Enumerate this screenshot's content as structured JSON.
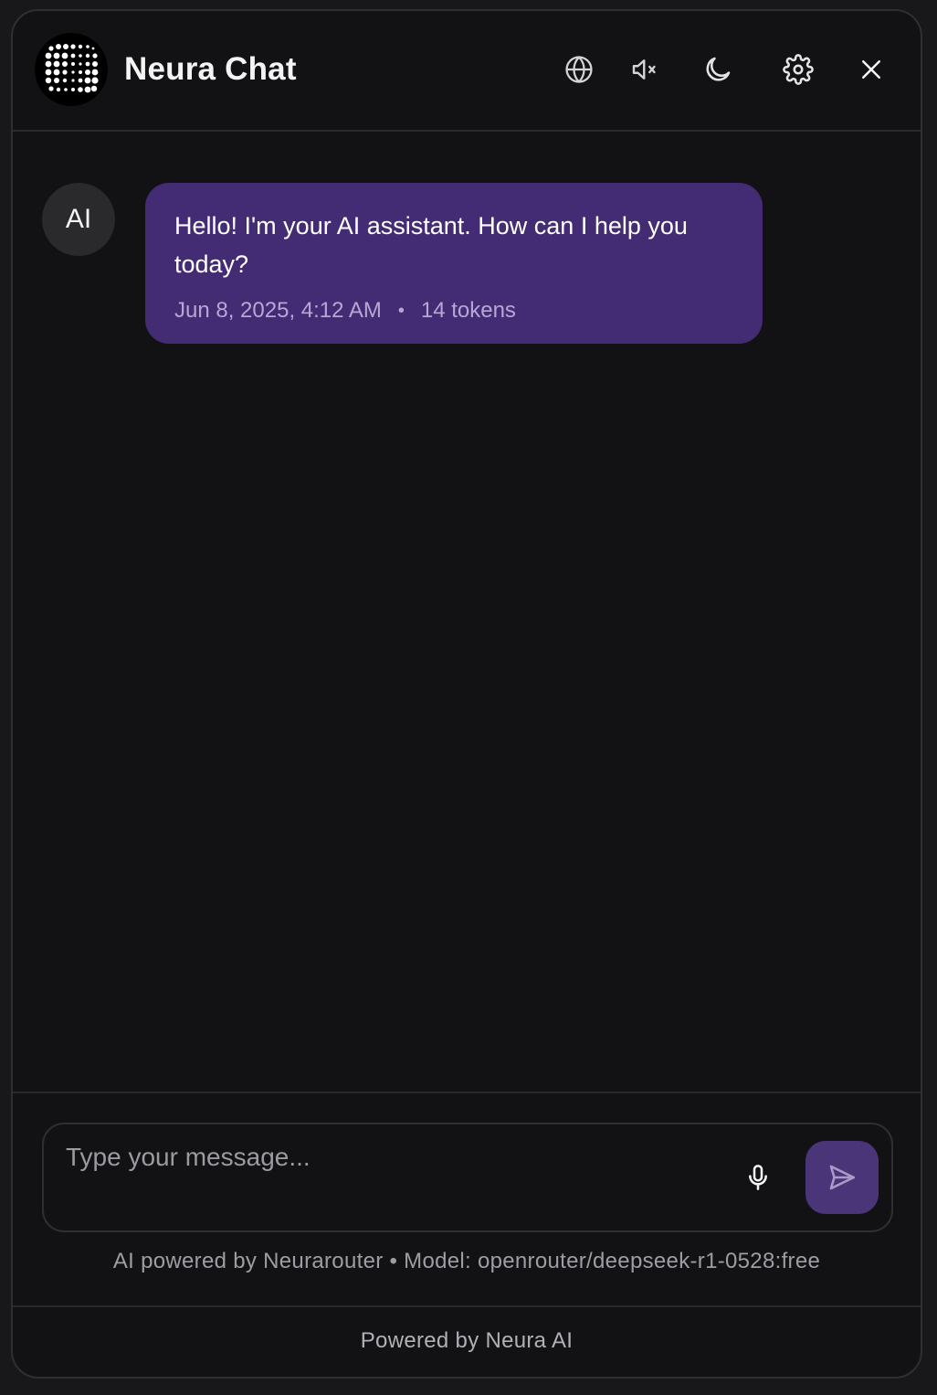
{
  "header": {
    "title": "Neura Chat",
    "icons": [
      "logo-icon",
      "globe-icon",
      "speaker-muted-icon",
      "moon-icon",
      "gear-icon",
      "close-icon"
    ]
  },
  "messages": [
    {
      "role_label": "AI",
      "text": "Hello! I'm your AI assistant. How can I help you today?",
      "timestamp": "Jun 8, 2025, 4:12 AM",
      "separator": "•",
      "tokens": "14 tokens"
    }
  ],
  "composer": {
    "placeholder": "Type your message...",
    "value": "",
    "icons": [
      "microphone-icon",
      "send-icon"
    ]
  },
  "model_info": "AI powered by Neurarouter • Model: openrouter/deepseek-r1-0528:free",
  "footer": {
    "text": "Powered by Neura AI"
  },
  "colors": {
    "background": "#121214",
    "bubble": "#442c74",
    "send_button": "#4b3579",
    "avatar": "#2a2a2d"
  }
}
